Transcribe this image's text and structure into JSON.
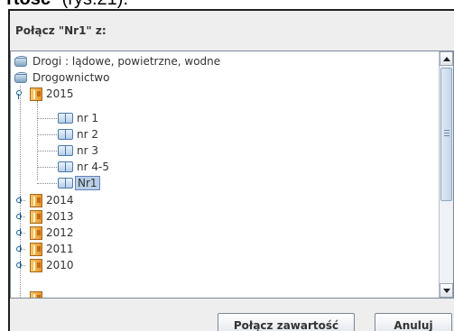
{
  "caption": {
    "bold": "rtość",
    "rest": "\" (rys.21)."
  },
  "dialog": {
    "title": "Połącz \"Nr1\" z:"
  },
  "tree": {
    "roots": [
      {
        "label": "Drogi : lądowe, powietrzne, wodne",
        "icon": "database-icon"
      },
      {
        "label": "Drogownictwo",
        "icon": "database-icon"
      }
    ],
    "year_open": {
      "label": "2015",
      "icon": "folder-icon",
      "expanded": true
    },
    "items": [
      {
        "label": "nr 1",
        "icon": "book-icon"
      },
      {
        "label": "nr 2",
        "icon": "book-icon"
      },
      {
        "label": "nr 3",
        "icon": "book-icon"
      },
      {
        "label": "nr 4-5",
        "icon": "book-icon"
      },
      {
        "label": "Nr1",
        "icon": "book-icon",
        "selected": true
      }
    ],
    "years": [
      {
        "label": "2014",
        "icon": "folder-icon",
        "expanded": false
      },
      {
        "label": "2013",
        "icon": "folder-icon",
        "expanded": false
      },
      {
        "label": "2012",
        "icon": "folder-icon",
        "expanded": false
      },
      {
        "label": "2011",
        "icon": "folder-icon",
        "expanded": false
      },
      {
        "label": "2010",
        "icon": "folder-icon",
        "expanded": false
      }
    ],
    "scroll_position": 0.0
  },
  "buttons": {
    "merge": "Połącz zawartość",
    "cancel": "Anuluj"
  },
  "colors": {
    "selection_bg": "#b8cfe5",
    "selection_border": "#6382bf",
    "dialog_bg": "#eeeeee"
  }
}
